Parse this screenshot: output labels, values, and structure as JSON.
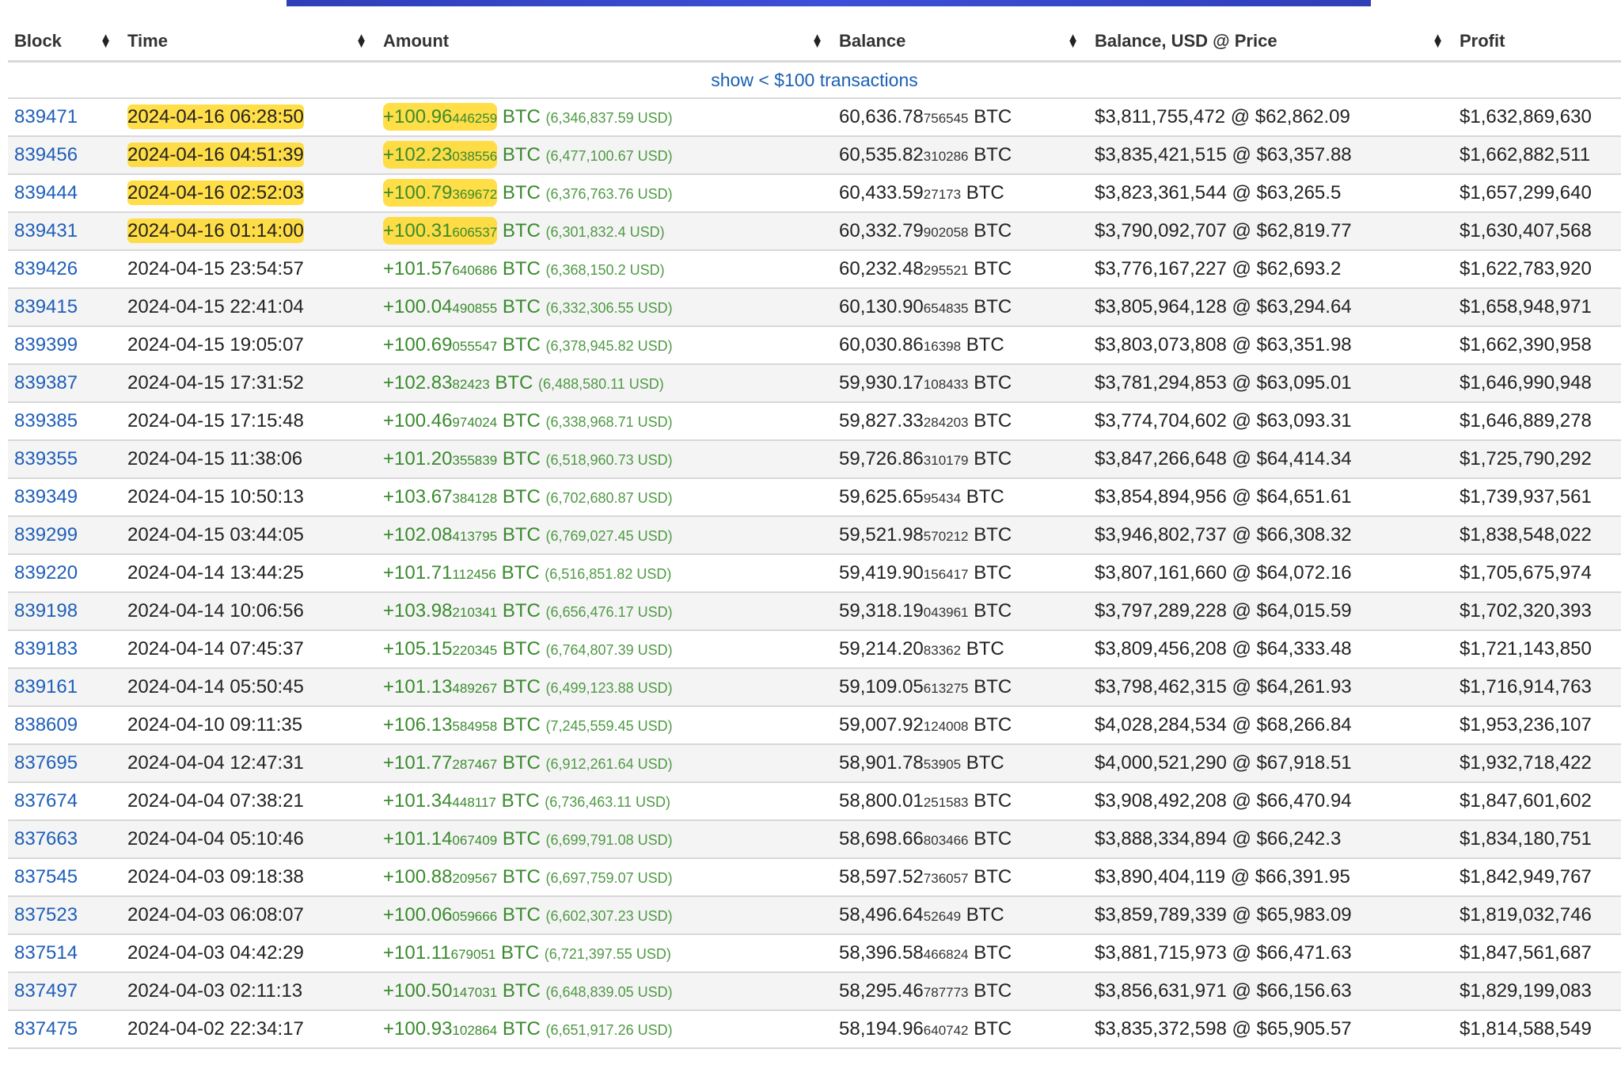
{
  "headers": {
    "block": "Block",
    "time": "Time",
    "amount": "Amount",
    "balance": "Balance",
    "balance_usd": "Balance, USD @ Price",
    "profit": "Profit"
  },
  "show_small": "show < $100 transactions",
  "rows": [
    {
      "block": "839471",
      "time": "2024-04-16 06:28:50",
      "amt": "+100.96",
      "amt_frac": "446259",
      "unit": "BTC",
      "usd": "(6,346,837.59 USD)",
      "bal": "60,636.78",
      "bal_frac": "756545",
      "bal_unit": "BTC",
      "bal_usd": "$3,811,755,472 @ $62,862.09",
      "profit": "$1,632,869,630",
      "highlight": true
    },
    {
      "block": "839456",
      "time": "2024-04-16 04:51:39",
      "amt": "+102.23",
      "amt_frac": "038556",
      "unit": "BTC",
      "usd": "(6,477,100.67 USD)",
      "bal": "60,535.82",
      "bal_frac": "310286",
      "bal_unit": "BTC",
      "bal_usd": "$3,835,421,515 @ $63,357.88",
      "profit": "$1,662,882,511",
      "highlight": true
    },
    {
      "block": "839444",
      "time": "2024-04-16 02:52:03",
      "amt": "+100.79",
      "amt_frac": "369672",
      "unit": "BTC",
      "usd": "(6,376,763.76 USD)",
      "bal": "60,433.59",
      "bal_frac": "27173",
      "bal_unit": "BTC",
      "bal_usd": "$3,823,361,544 @ $63,265.5",
      "profit": "$1,657,299,640",
      "highlight": true
    },
    {
      "block": "839431",
      "time": "2024-04-16 01:14:00",
      "amt": "+100.31",
      "amt_frac": "606537",
      "unit": "BTC",
      "usd": "(6,301,832.4 USD)",
      "bal": "60,332.79",
      "bal_frac": "902058",
      "bal_unit": "BTC",
      "bal_usd": "$3,790,092,707 @ $62,819.77",
      "profit": "$1,630,407,568",
      "highlight": true
    },
    {
      "block": "839426",
      "time": "2024-04-15 23:54:57",
      "amt": "+101.57",
      "amt_frac": "640686",
      "unit": "BTC",
      "usd": "(6,368,150.2 USD)",
      "bal": "60,232.48",
      "bal_frac": "295521",
      "bal_unit": "BTC",
      "bal_usd": "$3,776,167,227 @ $62,693.2",
      "profit": "$1,622,783,920",
      "highlight": false
    },
    {
      "block": "839415",
      "time": "2024-04-15 22:41:04",
      "amt": "+100.04",
      "amt_frac": "490855",
      "unit": "BTC",
      "usd": "(6,332,306.55 USD)",
      "bal": "60,130.90",
      "bal_frac": "654835",
      "bal_unit": "BTC",
      "bal_usd": "$3,805,964,128 @ $63,294.64",
      "profit": "$1,658,948,971",
      "highlight": false
    },
    {
      "block": "839399",
      "time": "2024-04-15 19:05:07",
      "amt": "+100.69",
      "amt_frac": "055547",
      "unit": "BTC",
      "usd": "(6,378,945.82 USD)",
      "bal": "60,030.86",
      "bal_frac": "16398",
      "bal_unit": "BTC",
      "bal_usd": "$3,803,073,808 @ $63,351.98",
      "profit": "$1,662,390,958",
      "highlight": false
    },
    {
      "block": "839387",
      "time": "2024-04-15 17:31:52",
      "amt": "+102.83",
      "amt_frac": "82423",
      "unit": "BTC",
      "usd": "(6,488,580.11 USD)",
      "bal": "59,930.17",
      "bal_frac": "108433",
      "bal_unit": "BTC",
      "bal_usd": "$3,781,294,853 @ $63,095.01",
      "profit": "$1,646,990,948",
      "highlight": false
    },
    {
      "block": "839385",
      "time": "2024-04-15 17:15:48",
      "amt": "+100.46",
      "amt_frac": "974024",
      "unit": "BTC",
      "usd": "(6,338,968.71 USD)",
      "bal": "59,827.33",
      "bal_frac": "284203",
      "bal_unit": "BTC",
      "bal_usd": "$3,774,704,602 @ $63,093.31",
      "profit": "$1,646,889,278",
      "highlight": false
    },
    {
      "block": "839355",
      "time": "2024-04-15 11:38:06",
      "amt": "+101.20",
      "amt_frac": "355839",
      "unit": "BTC",
      "usd": "(6,518,960.73 USD)",
      "bal": "59,726.86",
      "bal_frac": "310179",
      "bal_unit": "BTC",
      "bal_usd": "$3,847,266,648 @ $64,414.34",
      "profit": "$1,725,790,292",
      "highlight": false
    },
    {
      "block": "839349",
      "time": "2024-04-15 10:50:13",
      "amt": "+103.67",
      "amt_frac": "384128",
      "unit": "BTC",
      "usd": "(6,702,680.87 USD)",
      "bal": "59,625.65",
      "bal_frac": "95434",
      "bal_unit": "BTC",
      "bal_usd": "$3,854,894,956 @ $64,651.61",
      "profit": "$1,739,937,561",
      "highlight": false
    },
    {
      "block": "839299",
      "time": "2024-04-15 03:44:05",
      "amt": "+102.08",
      "amt_frac": "413795",
      "unit": "BTC",
      "usd": "(6,769,027.45 USD)",
      "bal": "59,521.98",
      "bal_frac": "570212",
      "bal_unit": "BTC",
      "bal_usd": "$3,946,802,737 @ $66,308.32",
      "profit": "$1,838,548,022",
      "highlight": false
    },
    {
      "block": "839220",
      "time": "2024-04-14 13:44:25",
      "amt": "+101.71",
      "amt_frac": "112456",
      "unit": "BTC",
      "usd": "(6,516,851.82 USD)",
      "bal": "59,419.90",
      "bal_frac": "156417",
      "bal_unit": "BTC",
      "bal_usd": "$3,807,161,660 @ $64,072.16",
      "profit": "$1,705,675,974",
      "highlight": false
    },
    {
      "block": "839198",
      "time": "2024-04-14 10:06:56",
      "amt": "+103.98",
      "amt_frac": "210341",
      "unit": "BTC",
      "usd": "(6,656,476.17 USD)",
      "bal": "59,318.19",
      "bal_frac": "043961",
      "bal_unit": "BTC",
      "bal_usd": "$3,797,289,228 @ $64,015.59",
      "profit": "$1,702,320,393",
      "highlight": false
    },
    {
      "block": "839183",
      "time": "2024-04-14 07:45:37",
      "amt": "+105.15",
      "amt_frac": "220345",
      "unit": "BTC",
      "usd": "(6,764,807.39 USD)",
      "bal": "59,214.20",
      "bal_frac": "83362",
      "bal_unit": "BTC",
      "bal_usd": "$3,809,456,208 @ $64,333.48",
      "profit": "$1,721,143,850",
      "highlight": false
    },
    {
      "block": "839161",
      "time": "2024-04-14 05:50:45",
      "amt": "+101.13",
      "amt_frac": "489267",
      "unit": "BTC",
      "usd": "(6,499,123.88 USD)",
      "bal": "59,109.05",
      "bal_frac": "613275",
      "bal_unit": "BTC",
      "bal_usd": "$3,798,462,315 @ $64,261.93",
      "profit": "$1,716,914,763",
      "highlight": false
    },
    {
      "block": "838609",
      "time": "2024-04-10 09:11:35",
      "amt": "+106.13",
      "amt_frac": "584958",
      "unit": "BTC",
      "usd": "(7,245,559.45 USD)",
      "bal": "59,007.92",
      "bal_frac": "124008",
      "bal_unit": "BTC",
      "bal_usd": "$4,028,284,534 @ $68,266.84",
      "profit": "$1,953,236,107",
      "highlight": false
    },
    {
      "block": "837695",
      "time": "2024-04-04 12:47:31",
      "amt": "+101.77",
      "amt_frac": "287467",
      "unit": "BTC",
      "usd": "(6,912,261.64 USD)",
      "bal": "58,901.78",
      "bal_frac": "53905",
      "bal_unit": "BTC",
      "bal_usd": "$4,000,521,290 @ $67,918.51",
      "profit": "$1,932,718,422",
      "highlight": false
    },
    {
      "block": "837674",
      "time": "2024-04-04 07:38:21",
      "amt": "+101.34",
      "amt_frac": "448117",
      "unit": "BTC",
      "usd": "(6,736,463.11 USD)",
      "bal": "58,800.01",
      "bal_frac": "251583",
      "bal_unit": "BTC",
      "bal_usd": "$3,908,492,208 @ $66,470.94",
      "profit": "$1,847,601,602",
      "highlight": false
    },
    {
      "block": "837663",
      "time": "2024-04-04 05:10:46",
      "amt": "+101.14",
      "amt_frac": "067409",
      "unit": "BTC",
      "usd": "(6,699,791.08 USD)",
      "bal": "58,698.66",
      "bal_frac": "803466",
      "bal_unit": "BTC",
      "bal_usd": "$3,888,334,894 @ $66,242.3",
      "profit": "$1,834,180,751",
      "highlight": false
    },
    {
      "block": "837545",
      "time": "2024-04-03 09:18:38",
      "amt": "+100.88",
      "amt_frac": "209567",
      "unit": "BTC",
      "usd": "(6,697,759.07 USD)",
      "bal": "58,597.52",
      "bal_frac": "736057",
      "bal_unit": "BTC",
      "bal_usd": "$3,890,404,119 @ $66,391.95",
      "profit": "$1,842,949,767",
      "highlight": false
    },
    {
      "block": "837523",
      "time": "2024-04-03 06:08:07",
      "amt": "+100.06",
      "amt_frac": "059666",
      "unit": "BTC",
      "usd": "(6,602,307.23 USD)",
      "bal": "58,496.64",
      "bal_frac": "52649",
      "bal_unit": "BTC",
      "bal_usd": "$3,859,789,339 @ $65,983.09",
      "profit": "$1,819,032,746",
      "highlight": false
    },
    {
      "block": "837514",
      "time": "2024-04-03 04:42:29",
      "amt": "+101.11",
      "amt_frac": "679051",
      "unit": "BTC",
      "usd": "(6,721,397.55 USD)",
      "bal": "58,396.58",
      "bal_frac": "466824",
      "bal_unit": "BTC",
      "bal_usd": "$3,881,715,973 @ $66,471.63",
      "profit": "$1,847,561,687",
      "highlight": false
    },
    {
      "block": "837497",
      "time": "2024-04-03 02:11:13",
      "amt": "+100.50",
      "amt_frac": "147031",
      "unit": "BTC",
      "usd": "(6,648,839.05 USD)",
      "bal": "58,295.46",
      "bal_frac": "787773",
      "bal_unit": "BTC",
      "bal_usd": "$3,856,631,971 @ $66,156.63",
      "profit": "$1,829,199,083",
      "highlight": false
    },
    {
      "block": "837475",
      "time": "2024-04-02 22:34:17",
      "amt": "+100.93",
      "amt_frac": "102864",
      "unit": "BTC",
      "usd": "(6,651,917.26 USD)",
      "bal": "58,194.96",
      "bal_frac": "640742",
      "bal_unit": "BTC",
      "bal_usd": "$3,835,372,598 @ $65,905.57",
      "profit": "$1,814,588,549",
      "highlight": false
    }
  ]
}
